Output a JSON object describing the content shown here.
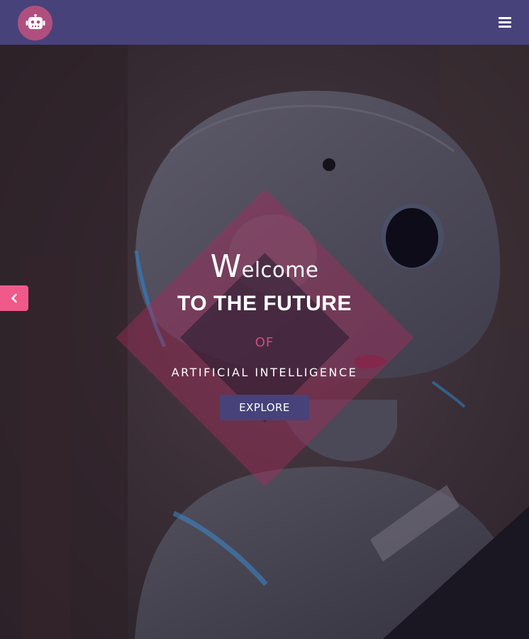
{
  "header": {
    "logo_icon": "robot-icon",
    "menu_icon": "hamburger-menu-icon"
  },
  "hero": {
    "welcome_initial": "W",
    "welcome_rest": "elcome",
    "headline": "TO THE FUTURE",
    "connector": "OF",
    "subheadline": "ARTIFICIAL INTELLIGENCE",
    "cta_label": "EXPLORE",
    "prev_icon": "chevron-left-icon"
  },
  "colors": {
    "header_bg": "#47427a",
    "logo_bg": "#b04f7e",
    "accent_pink": "#cf4d7f",
    "arrow_bg": "#f05a8a",
    "button_bg": "#47427a"
  }
}
